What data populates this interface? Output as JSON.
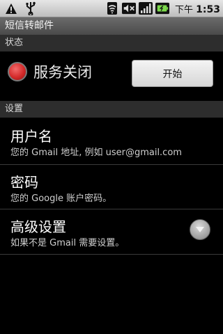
{
  "status_bar": {
    "time_prefix": "下午",
    "time": "1:53",
    "icons": [
      "warning-icon",
      "usb-icon",
      "wifi-icon",
      "mute-icon",
      "signal-icon",
      "battery-icon"
    ]
  },
  "app": {
    "title": "短信转邮件"
  },
  "status_section": {
    "header": "状态",
    "service_status": "服务关闭",
    "indicator_color": "#d42a2a",
    "start_button": "开始"
  },
  "settings_section": {
    "header": "设置",
    "items": [
      {
        "title": "用户名",
        "summary": "您的 Gmail 地址, 例如 user@gmail.com"
      },
      {
        "title": "密码",
        "summary": "您的 Google 账户密码。"
      },
      {
        "title": "高级设置",
        "summary": "如果不是 Gmail 需要设置。"
      }
    ]
  }
}
